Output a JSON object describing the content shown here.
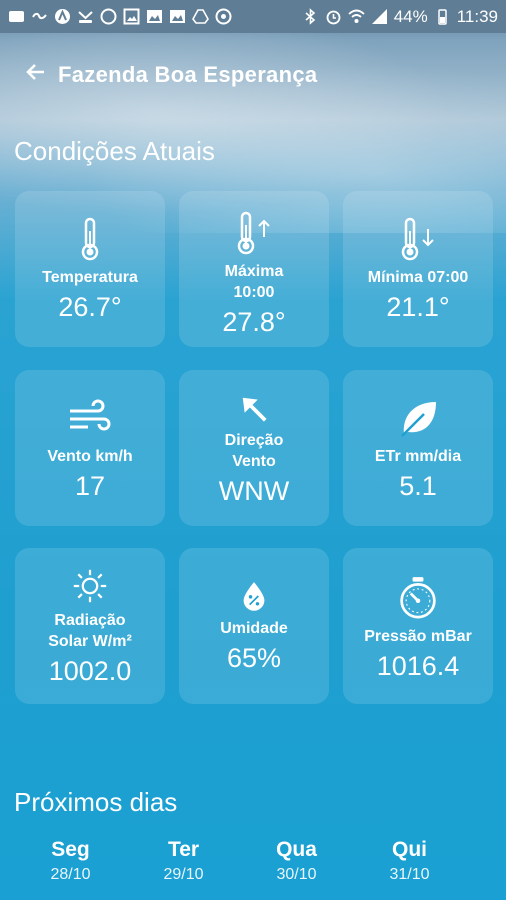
{
  "status_bar": {
    "battery": "44%",
    "time": "11:39"
  },
  "header": {
    "title": "Fazenda Boa Esperança"
  },
  "current": {
    "section_title": "Condições Atuais",
    "cards": [
      {
        "icon": "thermometer-icon",
        "label": "Temperatura",
        "value": "26.7°"
      },
      {
        "icon": "thermometer-up-icon",
        "label": "Máxima\n10:00",
        "value": "27.8°"
      },
      {
        "icon": "thermometer-down-icon",
        "label": "Mínima 07:00",
        "value": "21.1°"
      },
      {
        "icon": "wind-icon",
        "label": "Vento km/h",
        "value": "17"
      },
      {
        "icon": "wind-direction-arrow-icon",
        "label": "Direção\nVento",
        "value": "WNW"
      },
      {
        "icon": "leaf-icon",
        "label": "ETr mm/dia",
        "value": "5.1"
      },
      {
        "icon": "sun-icon",
        "label": "Radiação\nSolar W/m²",
        "value": "1002.0"
      },
      {
        "icon": "water-drop-percent-icon",
        "label": "Umidade",
        "value": "65%"
      },
      {
        "icon": "barometer-icon",
        "label": "Pressão mBar",
        "value": "1016.4"
      }
    ]
  },
  "forecast": {
    "section_title": "Próximos dias",
    "days": [
      {
        "name": "Seg",
        "date": "28/10"
      },
      {
        "name": "Ter",
        "date": "29/10"
      },
      {
        "name": "Qua",
        "date": "30/10"
      },
      {
        "name": "Qui",
        "date": "31/10"
      }
    ]
  }
}
